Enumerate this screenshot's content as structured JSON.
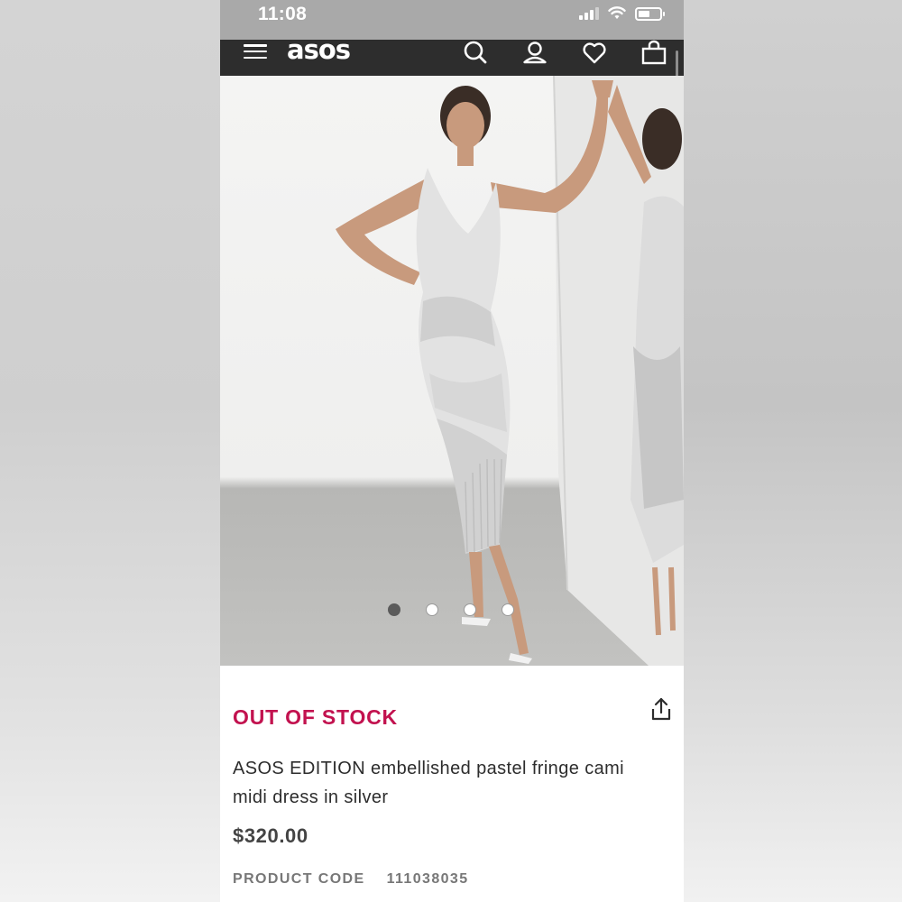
{
  "status_bar": {
    "time": "11:08"
  },
  "header": {
    "logo": "asos",
    "icons": [
      "menu-icon",
      "search-icon",
      "account-icon",
      "heart-icon",
      "bag-icon"
    ]
  },
  "gallery": {
    "image_count": 4,
    "active_index": 0
  },
  "product": {
    "stock_status": "OUT OF STOCK",
    "name": "ASOS EDITION embellished pastel fringe cami midi dress in silver",
    "price": "$320.00",
    "code_label": "PRODUCT CODE",
    "code_value": "111038035"
  },
  "colors": {
    "header_bg": "#2d2d2d",
    "out_of_stock": "#c2124f",
    "price": "#444444"
  }
}
